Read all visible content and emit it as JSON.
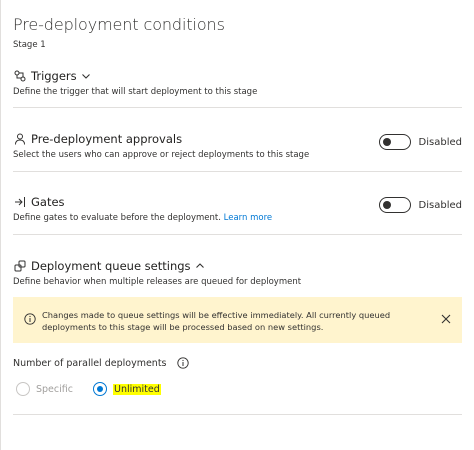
{
  "panel": {
    "title": "Pre-deployment conditions",
    "stage": "Stage 1"
  },
  "triggers": {
    "title": "Triggers",
    "description": "Define the trigger that will start deployment to this stage",
    "icon": "trigger-icon",
    "expanded": false
  },
  "approvals": {
    "title": "Pre-deployment approvals",
    "description": "Select the users who can approve or reject deployments to this stage",
    "icon": "person-icon",
    "toggle_label": "Disabled",
    "enabled": false
  },
  "gates": {
    "title": "Gates",
    "description": "Define gates to evaluate before the deployment.",
    "link": "Learn more",
    "icon": "gate-icon",
    "toggle_label": "Disabled",
    "enabled": false
  },
  "queue": {
    "title": "Deployment queue settings",
    "description": "Define behavior when multiple releases are queued for deployment",
    "icon": "queue-settings-icon",
    "expanded": true,
    "banner": {
      "text": "Changes made to queue settings will be effective immediately. All currently queued deployments to this stage will be processed based on new settings.",
      "background": "#fff4ce"
    },
    "parallel_label": "Number of parallel deployments",
    "options": [
      {
        "label": "Specific",
        "selected": false
      },
      {
        "label": "Unlimited",
        "selected": true
      }
    ]
  },
  "colors": {
    "accent": "#0078d4",
    "highlight": "#ffff00"
  }
}
